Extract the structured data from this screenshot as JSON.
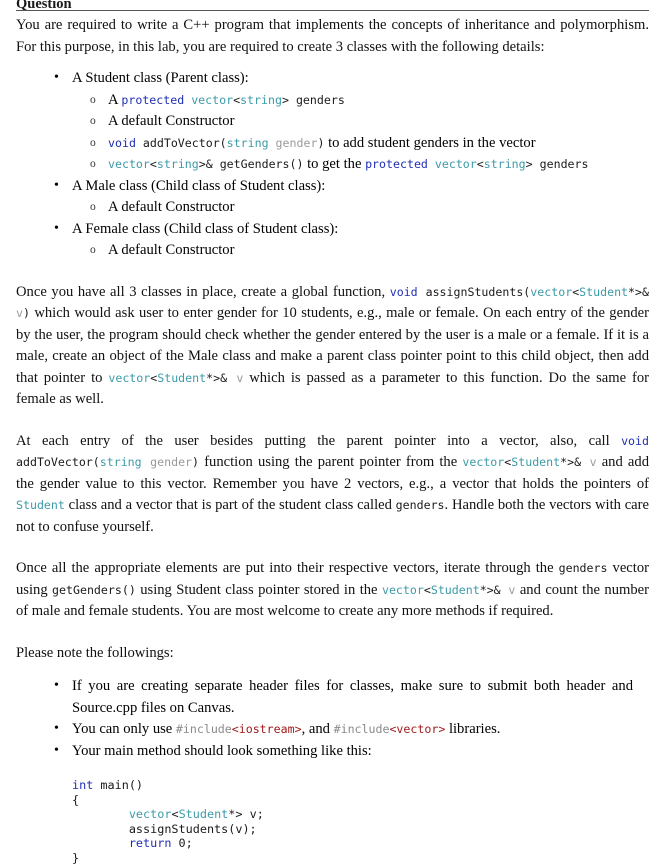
{
  "document": {
    "heading": "Question",
    "intro": {
      "text": "You are required to write a C++ program that implements the concepts of inheritance and polymorphism. For this purpose, in this lab, you are required to create 3 classes with the following details:"
    },
    "classes": [
      {
        "title": "A Student class (Parent class):",
        "items": [
          {
            "kind": "code-mixed",
            "tokens": [
              {
                "t": "A ",
                "c": "text"
              },
              {
                "t": "protected",
                "c": "kw"
              },
              {
                "t": " ",
                "c": "plain"
              },
              {
                "t": "vector",
                "c": "type"
              },
              {
                "t": "<",
                "c": "plain"
              },
              {
                "t": "string",
                "c": "type"
              },
              {
                "t": "> ",
                "c": "plain"
              },
              {
                "t": "genders",
                "c": "plain"
              }
            ]
          },
          {
            "kind": "text",
            "tokens": [
              {
                "t": "A default Constructor",
                "c": "text"
              }
            ]
          },
          {
            "kind": "code-mixed",
            "tokens": [
              {
                "t": "void",
                "c": "kw"
              },
              {
                "t": " addToVector(",
                "c": "plain"
              },
              {
                "t": "string",
                "c": "type"
              },
              {
                "t": " ",
                "c": "plain"
              },
              {
                "t": "gender",
                "c": "param"
              },
              {
                "t": ")",
                "c": "plain"
              },
              {
                "t": " to add student genders in the vector",
                "c": "text"
              }
            ]
          },
          {
            "kind": "code-mixed",
            "tokens": [
              {
                "t": "vector",
                "c": "type"
              },
              {
                "t": "<",
                "c": "plain"
              },
              {
                "t": "string",
                "c": "type"
              },
              {
                "t": ">& getGenders()",
                "c": "plain"
              },
              {
                "t": " to get the ",
                "c": "text"
              },
              {
                "t": "protected",
                "c": "kw"
              },
              {
                "t": " ",
                "c": "plain"
              },
              {
                "t": "vector",
                "c": "type"
              },
              {
                "t": "<",
                "c": "plain"
              },
              {
                "t": "string",
                "c": "type"
              },
              {
                "t": "> ",
                "c": "plain"
              },
              {
                "t": "genders",
                "c": "plain"
              }
            ]
          }
        ]
      },
      {
        "title": "A Male class (Child class of Student class):",
        "items": [
          {
            "kind": "text",
            "tokens": [
              {
                "t": "A default Constructor",
                "c": "text"
              }
            ]
          }
        ]
      },
      {
        "title": "A Female class (Child class of Student class):",
        "items": [
          {
            "kind": "text",
            "tokens": [
              {
                "t": "A default Constructor",
                "c": "text"
              }
            ]
          }
        ]
      }
    ],
    "paragraphs": [
      {
        "id": "para-once-you-have",
        "tokens": [
          {
            "t": "Once you have all 3 classes in place, create a global function, ",
            "c": "text"
          },
          {
            "t": "void",
            "c": "kw"
          },
          {
            "t": " assignStudents(",
            "c": "plain"
          },
          {
            "t": "vector",
            "c": "type"
          },
          {
            "t": "<",
            "c": "plain"
          },
          {
            "t": "Student",
            "c": "type"
          },
          {
            "t": "*>& ",
            "c": "plain"
          },
          {
            "t": "v",
            "c": "param"
          },
          {
            "t": ")",
            "c": "plain"
          },
          {
            "t": " which would ask user to enter gender for 10 students, e.g., male or female. On each entry of the gender by the user, the program should check whether the gender entered by the user is a male or a female. If it is a male, create an object of the Male class and make a parent class pointer point to this child object, then add that pointer to ",
            "c": "text"
          },
          {
            "t": "vector",
            "c": "type"
          },
          {
            "t": "<",
            "c": "plain"
          },
          {
            "t": "Student",
            "c": "type"
          },
          {
            "t": "*>& ",
            "c": "plain"
          },
          {
            "t": "v",
            "c": "param"
          },
          {
            "t": " which is passed as a parameter to this function. Do the same for female as well.",
            "c": "text"
          }
        ]
      },
      {
        "id": "para-at-each-entry",
        "tokens": [
          {
            "t": "At each entry of the user besides putting the parent pointer into a vector, also, call ",
            "c": "text"
          },
          {
            "t": "void",
            "c": "kw"
          },
          {
            "t": " addToVector(",
            "c": "plain"
          },
          {
            "t": "string",
            "c": "type"
          },
          {
            "t": " ",
            "c": "plain"
          },
          {
            "t": "gender",
            "c": "param"
          },
          {
            "t": ")",
            "c": "plain"
          },
          {
            "t": " function using the parent pointer from the ",
            "c": "text"
          },
          {
            "t": "vector",
            "c": "type"
          },
          {
            "t": "<",
            "c": "plain"
          },
          {
            "t": "Student",
            "c": "type"
          },
          {
            "t": "*>& ",
            "c": "plain"
          },
          {
            "t": "v",
            "c": "param"
          },
          {
            "t": " and add the gender value to this vector. Remember you have 2 vectors, e.g., a vector that holds the pointers of ",
            "c": "text"
          },
          {
            "t": "Student",
            "c": "type"
          },
          {
            "t": " class and a vector that is part of the student class called ",
            "c": "text"
          },
          {
            "t": "genders",
            "c": "plain"
          },
          {
            "t": ". Handle both the vectors with care not to confuse yourself.",
            "c": "text"
          }
        ]
      },
      {
        "id": "para-once-all",
        "tokens": [
          {
            "t": "Once all the appropriate elements are put into their respective vectors, iterate through the ",
            "c": "text"
          },
          {
            "t": "genders",
            "c": "plain"
          },
          {
            "t": " vector using ",
            "c": "text"
          },
          {
            "t": "getGenders()",
            "c": "plain"
          },
          {
            "t": " using Student class pointer stored in the ",
            "c": "text"
          },
          {
            "t": "vector",
            "c": "type"
          },
          {
            "t": "<",
            "c": "plain"
          },
          {
            "t": "Student",
            "c": "type"
          },
          {
            "t": "*>& ",
            "c": "plain"
          },
          {
            "t": "v",
            "c": "param"
          },
          {
            "t": " and count the number of male and female students. You are most welcome to create any more methods if required.",
            "c": "text"
          }
        ]
      }
    ],
    "note_intro": "Please note the followings:",
    "notes": [
      {
        "id": "note-header-files",
        "tokens": [
          {
            "t": "If you are creating separate header files for classes, make sure to submit both header and Source.cpp files on Canvas.",
            "c": "text"
          }
        ]
      },
      {
        "id": "note-includes",
        "tokens": [
          {
            "t": "You can only use ",
            "c": "text"
          },
          {
            "t": "#include",
            "c": "inc"
          },
          {
            "t": "<iostream>",
            "c": "str"
          },
          {
            "t": ", and ",
            "c": "text"
          },
          {
            "t": "#include",
            "c": "inc"
          },
          {
            "t": "<vector>",
            "c": "str"
          },
          {
            "t": " libraries.",
            "c": "text"
          }
        ]
      },
      {
        "id": "note-main-method",
        "tokens": [
          {
            "t": "Your main method should look something like this:",
            "c": "text"
          }
        ]
      }
    ],
    "code_block": [
      {
        "id": "code-line-1",
        "tokens": [
          {
            "t": "int",
            "c": "kw"
          },
          {
            "t": " main()",
            "c": "plain"
          }
        ]
      },
      {
        "id": "code-line-2",
        "tokens": [
          {
            "t": "{",
            "c": "plain"
          }
        ]
      },
      {
        "id": "code-line-3",
        "tokens": [
          {
            "t": "        ",
            "c": "plain"
          },
          {
            "t": "vector",
            "c": "type"
          },
          {
            "t": "<",
            "c": "plain"
          },
          {
            "t": "Student",
            "c": "type"
          },
          {
            "t": "*> v;",
            "c": "plain"
          }
        ]
      },
      {
        "id": "code-line-4",
        "tokens": [
          {
            "t": "        assignStudents(v);",
            "c": "plain"
          }
        ]
      },
      {
        "id": "code-line-5",
        "tokens": [
          {
            "t": "        ",
            "c": "plain"
          },
          {
            "t": "return",
            "c": "kw"
          },
          {
            "t": " 0;",
            "c": "plain"
          }
        ]
      },
      {
        "id": "code-line-6",
        "tokens": [
          {
            "t": "}",
            "c": "plain"
          }
        ]
      }
    ],
    "colors": {
      "keyword": "#1f2fb5",
      "type": "#3c9ba8",
      "param": "#9a9a9a",
      "include": "#8a8a8a",
      "string_literal": "#a01b1b",
      "body_text": "#111111",
      "rule": "#555555"
    }
  }
}
